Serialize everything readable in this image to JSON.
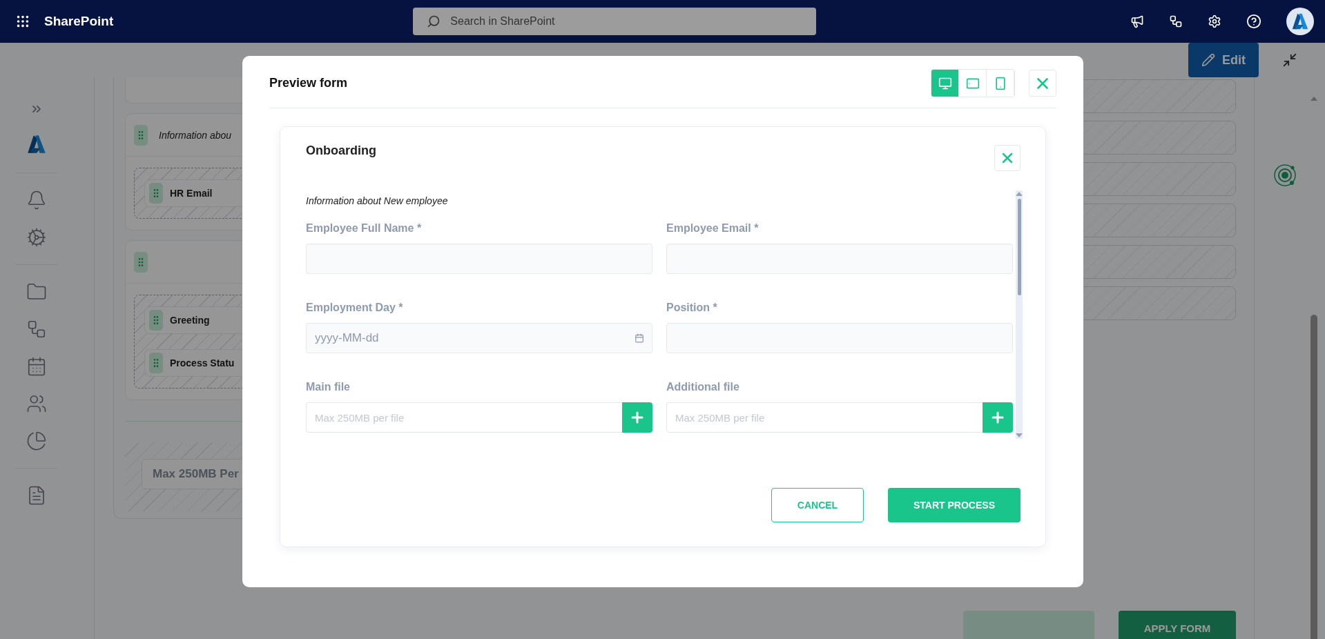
{
  "topbar": {
    "app_name": "SharePoint",
    "search": {
      "placeholder": "Search in SharePoint"
    }
  },
  "background": {
    "edit_button": "Edit",
    "cards": [
      {
        "kind": "stub"
      },
      {
        "kind": "section",
        "title": "Information abou",
        "items": [
          "HR Email"
        ]
      },
      {
        "kind": "section",
        "items": [
          "Greeting",
          "Process Statu"
        ]
      }
    ],
    "upload_hint": "Max 250MB Per",
    "apply_button": "APPLY FORM"
  },
  "modal": {
    "title": "Preview form",
    "devices": [
      {
        "kind": "desktop",
        "selected": true
      },
      {
        "kind": "tablet",
        "selected": false
      },
      {
        "kind": "phone",
        "selected": false
      }
    ],
    "form": {
      "title": "Onboarding",
      "description": "Information about New employee",
      "fields": [
        {
          "kind": "text",
          "label": "Employee Full Name *"
        },
        {
          "kind": "text",
          "label": "Employee Email *"
        },
        {
          "kind": "date",
          "label": "Employment Day *",
          "placeholder": "yyyy-MM-dd"
        },
        {
          "kind": "text",
          "label": "Position *"
        },
        {
          "kind": "file",
          "label": "Main file",
          "placeholder": "Max 250MB per file"
        },
        {
          "kind": "file",
          "label": "Additional file",
          "placeholder": "Max 250MB per file"
        }
      ],
      "cancel_button": "CANCEL",
      "submit_button": "START PROCESS"
    }
  }
}
